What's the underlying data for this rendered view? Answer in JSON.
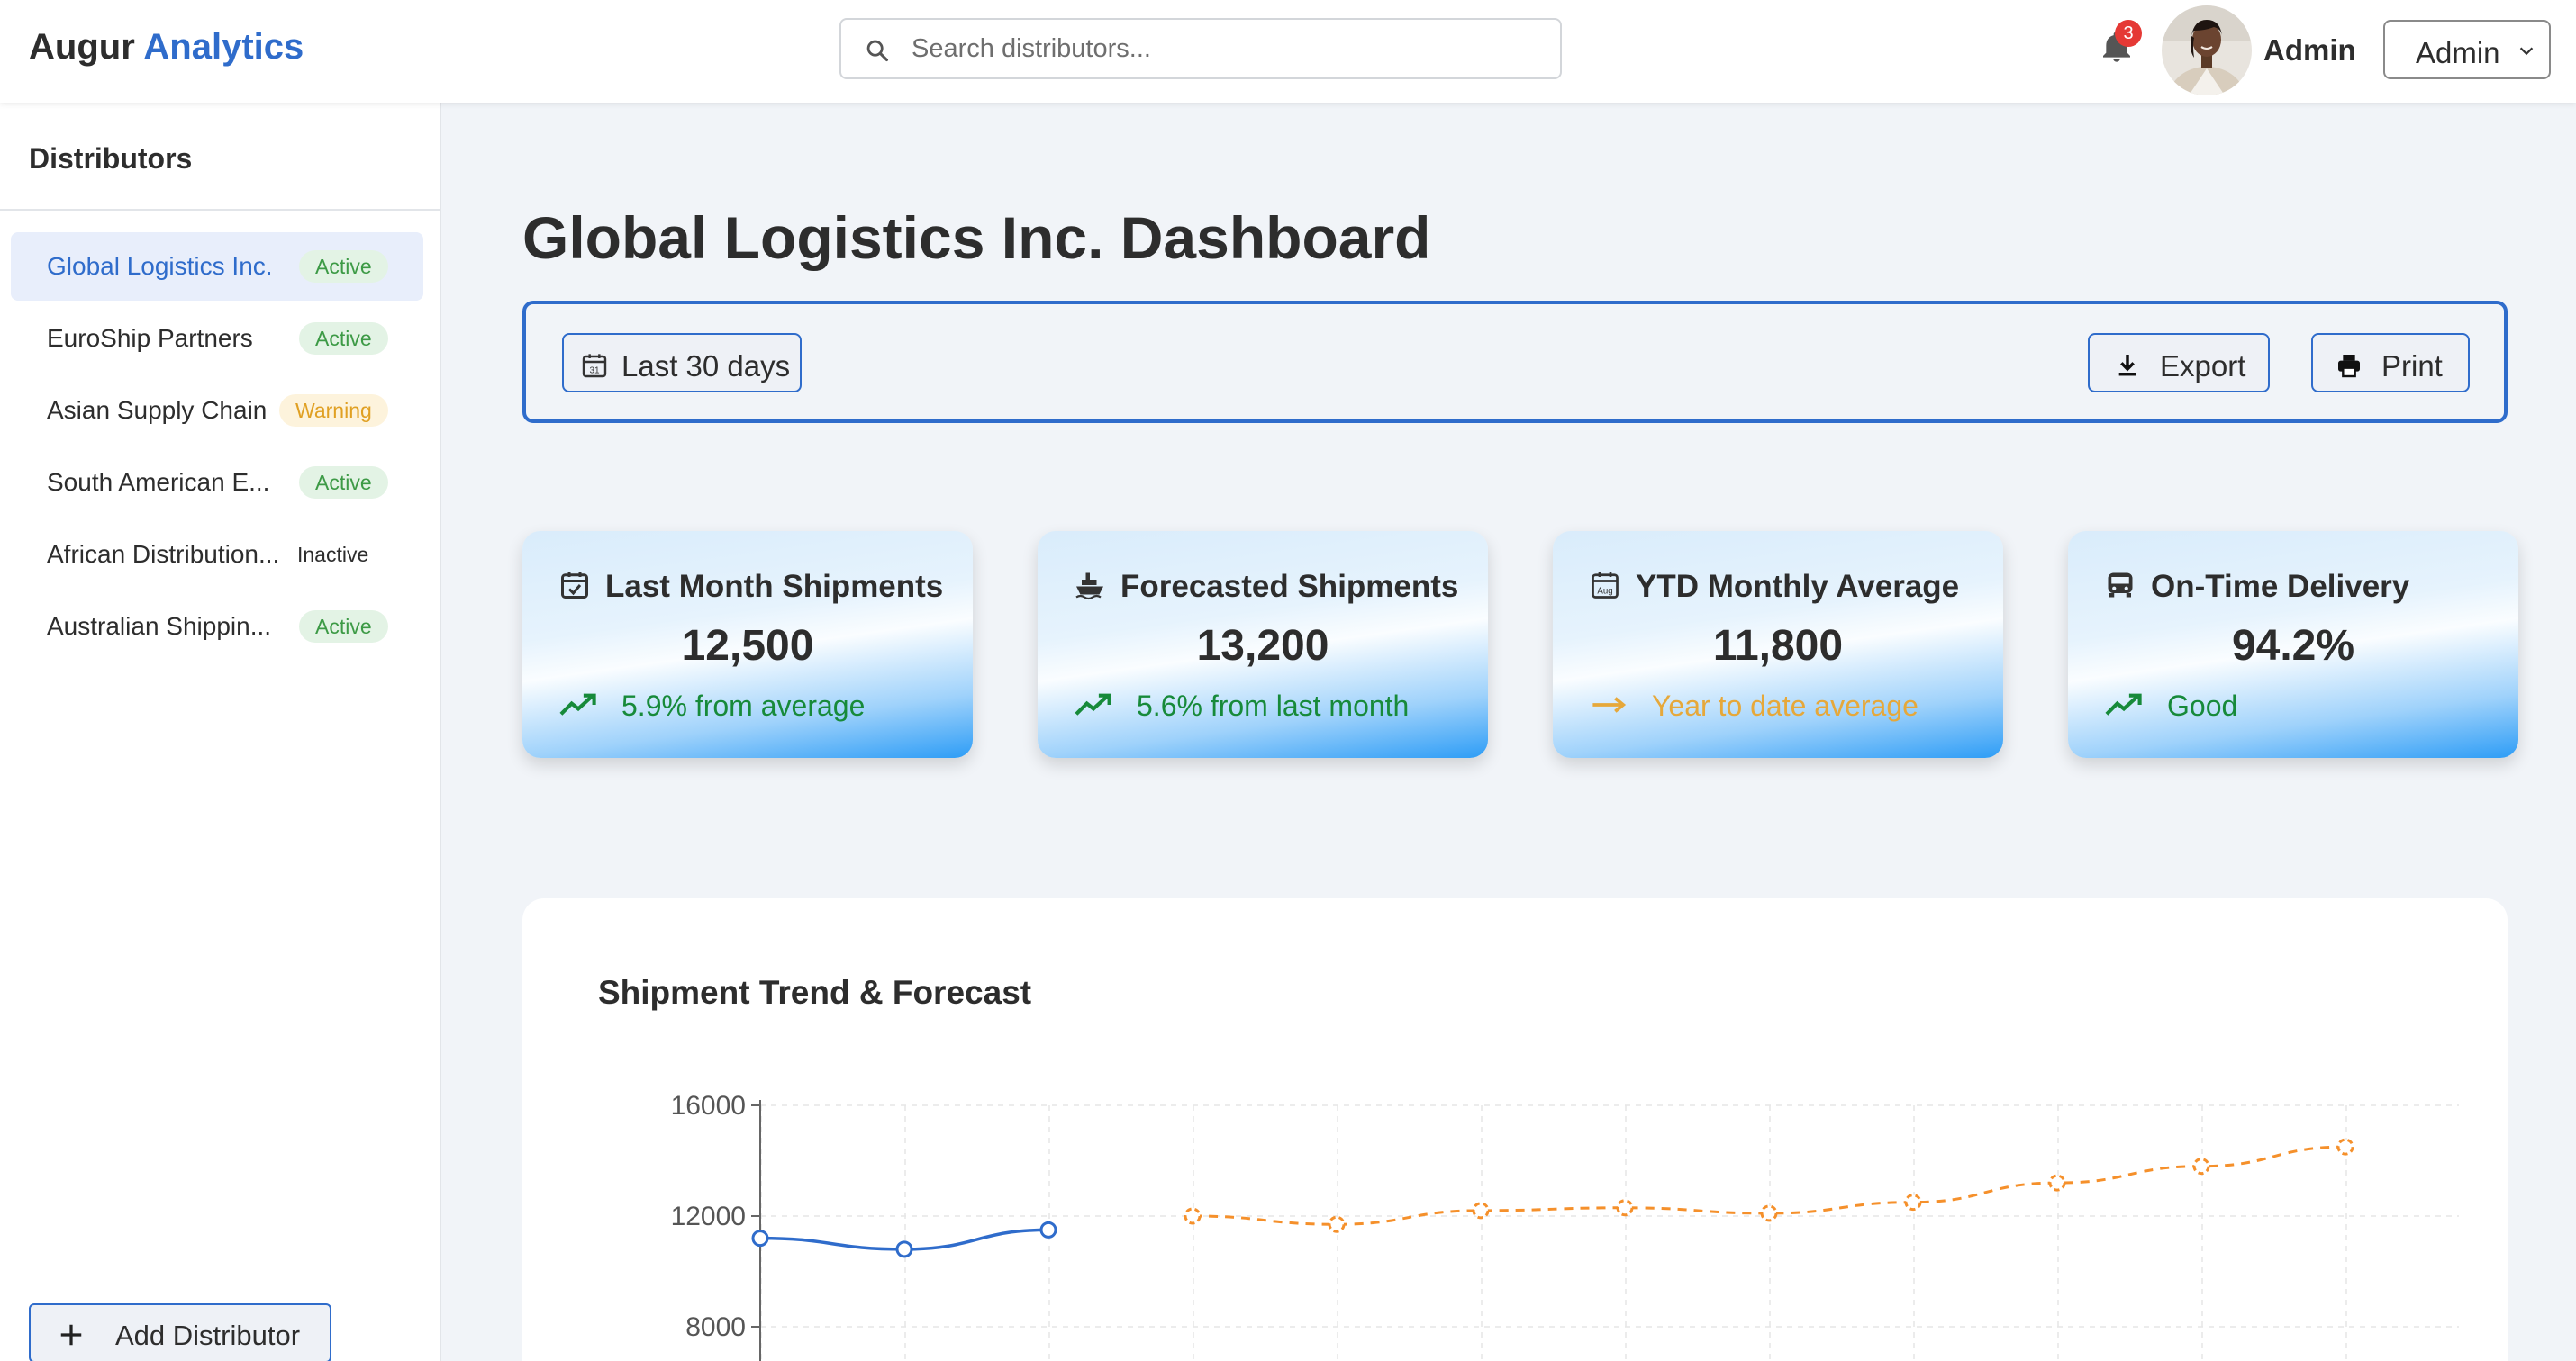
{
  "header": {
    "brand_main": "Augur",
    "brand_accent": "Analytics",
    "search_placeholder": "Search distributors...",
    "notifications_count": "3",
    "user_name": "Admin",
    "role_selected": "Admin"
  },
  "sidebar": {
    "title": "Distributors",
    "items": [
      {
        "name": "Global Logistics Inc.",
        "status": "Active",
        "status_type": "active",
        "selected": true
      },
      {
        "name": "EuroShip Partners",
        "status": "Active",
        "status_type": "active",
        "selected": false
      },
      {
        "name": "Asian Supply Chain",
        "status": "Warning",
        "status_type": "warning",
        "selected": false
      },
      {
        "name": "South American E...",
        "status": "Active",
        "status_type": "active",
        "selected": false
      },
      {
        "name": "African Distribution...",
        "status": "Inactive",
        "status_type": "inactive",
        "selected": false
      },
      {
        "name": "Australian Shippin...",
        "status": "Active",
        "status_type": "active",
        "selected": false
      }
    ],
    "add_button_label": "Add Distributor"
  },
  "main": {
    "title": "Global Logistics Inc. Dashboard",
    "toolbar": {
      "date_range": "Last 30 days",
      "export_label": "Export",
      "print_label": "Print"
    },
    "cards": [
      {
        "icon": "calendar-check-icon",
        "title": "Last Month Shipments",
        "value": "12,500",
        "trend_icon": "trending-up-icon",
        "trend": "5.9% from average",
        "trend_type": "up"
      },
      {
        "icon": "ship-icon",
        "title": "Forecasted Shipments",
        "value": "13,200",
        "trend_icon": "trending-up-icon",
        "trend": "5.6% from last month",
        "trend_type": "up"
      },
      {
        "icon": "calendar-month-icon",
        "title": "YTD Monthly Average",
        "value": "11,800",
        "trend_icon": "arrow-right-icon",
        "trend": "Year to date average",
        "trend_type": "flat"
      },
      {
        "icon": "truck-icon",
        "title": "On-Time Delivery",
        "value": "94.2%",
        "trend_icon": "trending-up-icon",
        "trend": "Good",
        "trend_type": "up"
      }
    ]
  },
  "colors": {
    "accent": "#2f6ccb",
    "actual_line": "#2f6ccb",
    "forecast_line": "#f5902b",
    "trend_up": "#178a3a",
    "trend_flat": "#e6a83a"
  },
  "chart_data": {
    "type": "line",
    "title": "Shipment Trend & Forecast",
    "xlabel": "",
    "ylabel": "",
    "ylim": [
      8000,
      16000
    ],
    "yticks": [
      16000,
      12000,
      8000
    ],
    "grid": true,
    "series": [
      {
        "style": "solid",
        "x": [
          0,
          1,
          2
        ],
        "values": [
          11200,
          10800,
          11500
        ]
      },
      {
        "style": "dashed",
        "x": [
          3,
          4,
          5,
          6,
          7,
          8,
          9,
          10,
          11
        ],
        "values": [
          12000,
          11700,
          12200,
          12300,
          12100,
          12500,
          13200,
          13800,
          14500
        ]
      }
    ]
  }
}
